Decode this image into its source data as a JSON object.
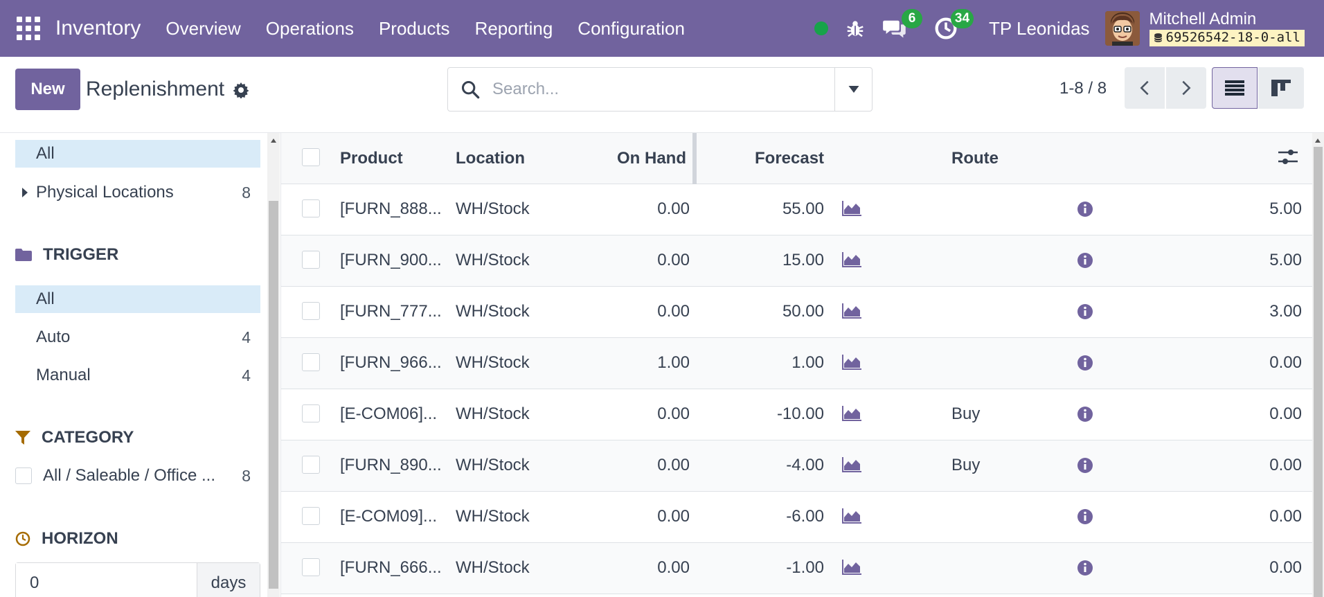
{
  "navbar": {
    "app_name": "Inventory",
    "menus": [
      "Overview",
      "Operations",
      "Products",
      "Reporting",
      "Configuration"
    ],
    "messages_count": "6",
    "activities_count": "34",
    "company": "TP Leonidas",
    "user_name": "Mitchell Admin",
    "db_name": "69526542-18-0-all",
    "colors": {
      "primary": "#71639e",
      "badge": "#28a745",
      "status": "#17a34a"
    }
  },
  "control": {
    "new_label": "New",
    "title": "Replenishment",
    "search_placeholder": "Search...",
    "pager": "1-8 / 8"
  },
  "sidebar": {
    "locations": {
      "all_label": "All",
      "physical_label": "Physical Locations",
      "physical_count": "8"
    },
    "trigger": {
      "heading": "TRIGGER",
      "all_label": "All",
      "items": [
        {
          "label": "Auto",
          "count": "4"
        },
        {
          "label": "Manual",
          "count": "4"
        }
      ]
    },
    "category": {
      "heading": "CATEGORY",
      "item_label": "All / Saleable / Office ...",
      "item_count": "8"
    },
    "horizon": {
      "heading": "HORIZON",
      "value": "0",
      "unit": "days"
    }
  },
  "table": {
    "headers": {
      "product": "Product",
      "location": "Location",
      "on_hand": "On Hand",
      "forecast": "Forecast",
      "route": "Route"
    },
    "rows": [
      {
        "product": "[FURN_888...",
        "location": "WH/Stock",
        "on_hand": "0.00",
        "forecast": "55.00",
        "route": "",
        "min": "5.00"
      },
      {
        "product": "[FURN_900...",
        "location": "WH/Stock",
        "on_hand": "0.00",
        "forecast": "15.00",
        "route": "",
        "min": "5.00"
      },
      {
        "product": "[FURN_777...",
        "location": "WH/Stock",
        "on_hand": "0.00",
        "forecast": "50.00",
        "route": "",
        "min": "3.00"
      },
      {
        "product": "[FURN_966...",
        "location": "WH/Stock",
        "on_hand": "1.00",
        "forecast": "1.00",
        "route": "",
        "min": "0.00"
      },
      {
        "product": "[E-COM06]...",
        "location": "WH/Stock",
        "on_hand": "0.00",
        "forecast": "-10.00",
        "route": "Buy",
        "min": "0.00"
      },
      {
        "product": "[FURN_890...",
        "location": "WH/Stock",
        "on_hand": "0.00",
        "forecast": "-4.00",
        "route": "Buy",
        "min": "0.00"
      },
      {
        "product": "[E-COM09]...",
        "location": "WH/Stock",
        "on_hand": "0.00",
        "forecast": "-6.00",
        "route": "",
        "min": "0.00"
      },
      {
        "product": "[FURN_666...",
        "location": "WH/Stock",
        "on_hand": "0.00",
        "forecast": "-1.00",
        "route": "",
        "min": "0.00"
      }
    ]
  }
}
